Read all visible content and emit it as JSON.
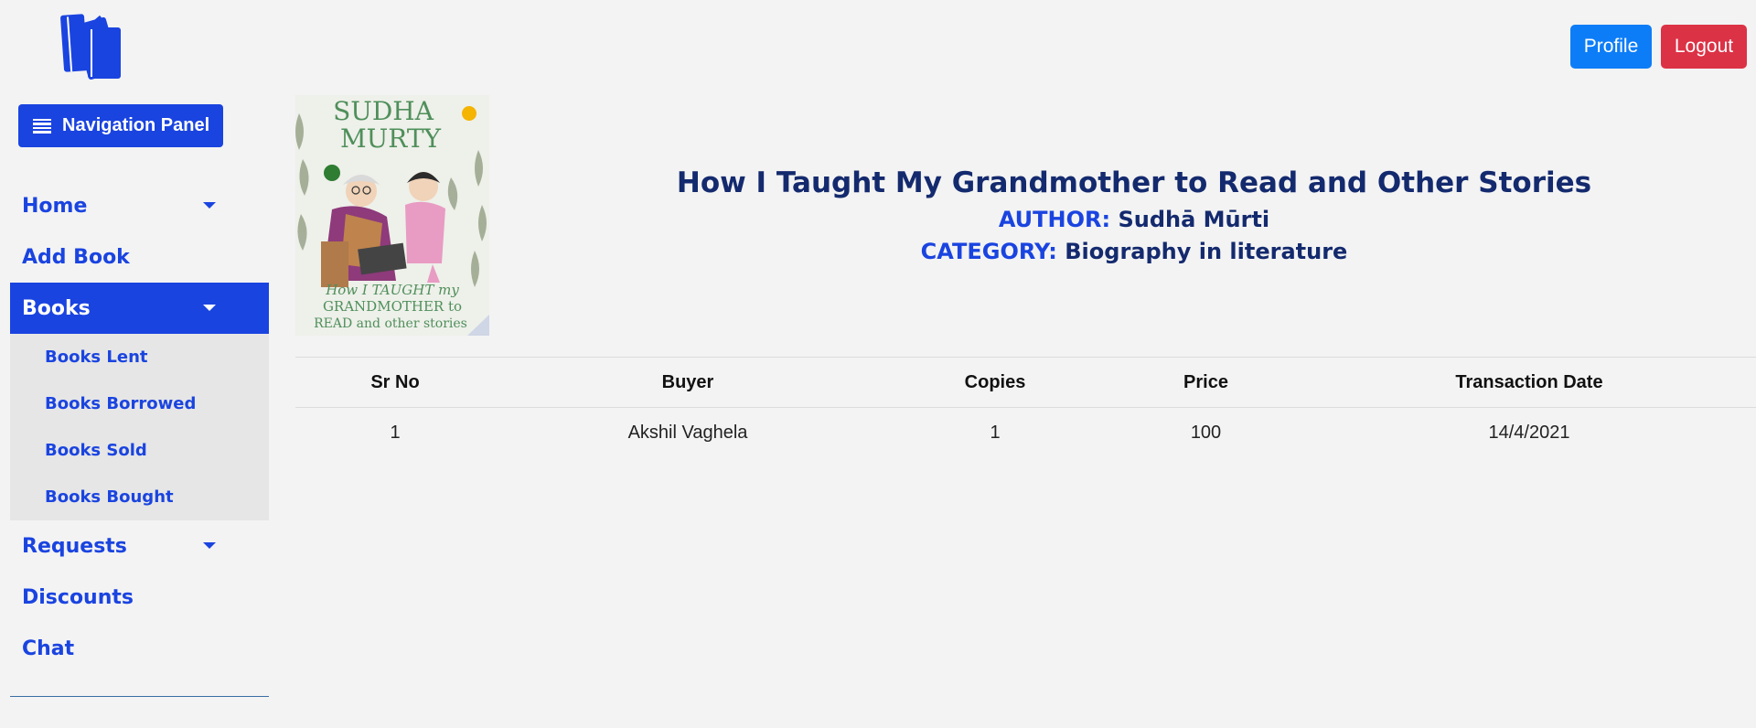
{
  "sidebar": {
    "nav_button_label": "Navigation Panel",
    "items": [
      {
        "label": "Home"
      },
      {
        "label": "Add Book"
      },
      {
        "label": "Books"
      },
      {
        "label": "Requests"
      },
      {
        "label": "Discounts"
      },
      {
        "label": "Chat"
      }
    ],
    "books_submenu": [
      {
        "label": "Books Lent"
      },
      {
        "label": "Books Borrowed"
      },
      {
        "label": "Books Sold"
      },
      {
        "label": "Books Bought"
      }
    ]
  },
  "header": {
    "profile_label": "Profile",
    "logout_label": "Logout"
  },
  "book": {
    "title": "How I Taught My Grandmother to Read and Other Stories",
    "author_label": "AUTHOR:",
    "author": "Sudhā Mūrti",
    "category_label": "CATEGORY:",
    "category": "Biography in literature",
    "cover": {
      "author_line1": "SUDHA",
      "author_line2": "MURTY",
      "title_line1": "How I TAUGHT my",
      "title_line2": "GRANDMOTHER to",
      "title_line3": "READ and other stories"
    }
  },
  "table": {
    "headers": [
      "Sr No",
      "Buyer",
      "Copies",
      "Price",
      "Transaction Date"
    ],
    "rows": [
      [
        "1",
        "Akshil Vaghela",
        "1",
        "100",
        "14/4/2021"
      ]
    ]
  },
  "colors": {
    "primary": "#1a44e0",
    "title": "#142a6e",
    "profile": "#0d7df7",
    "logout": "#dc3246",
    "background": "#f3f3f3"
  }
}
